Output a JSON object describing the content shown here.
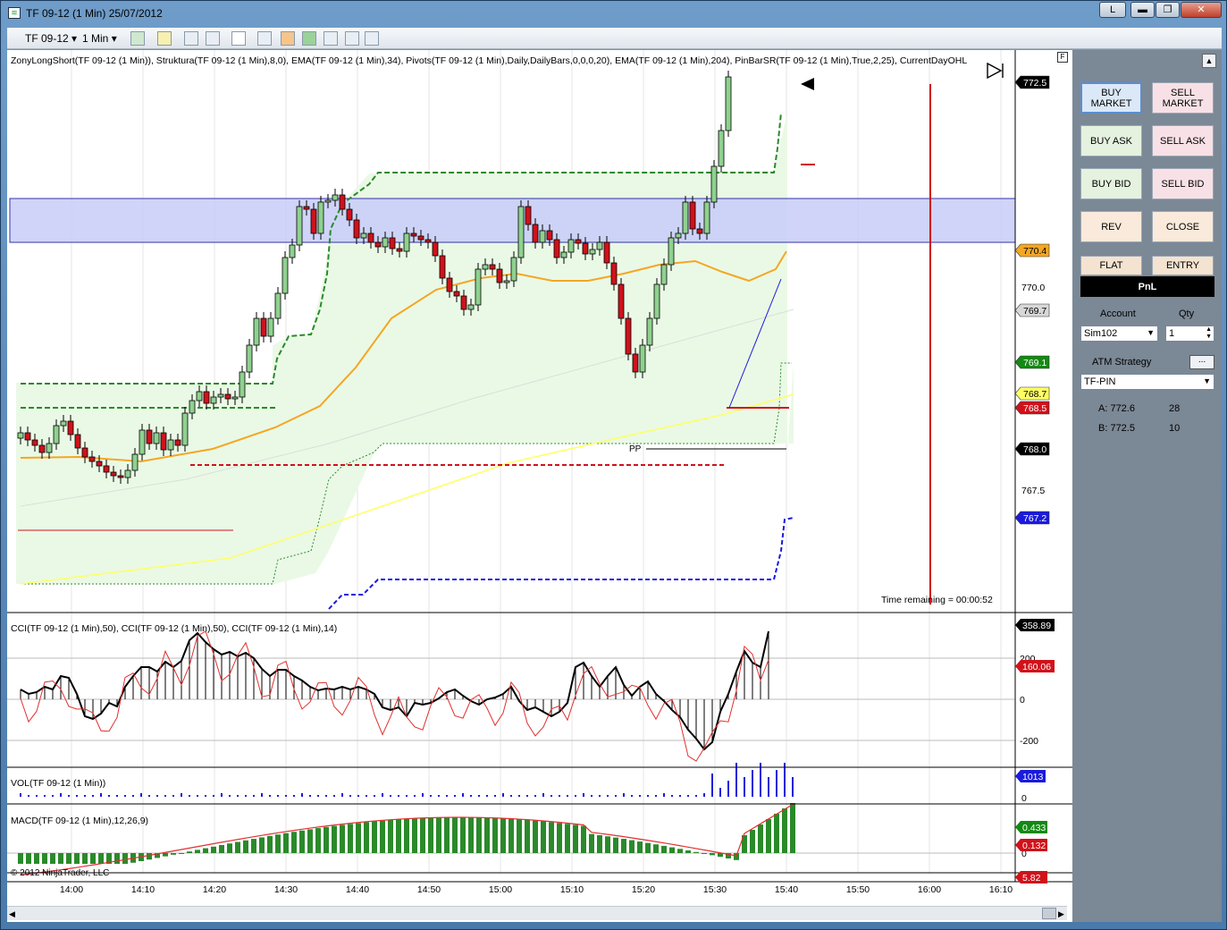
{
  "window": {
    "title": "TF 09-12 (1 Min)  25/07/2012",
    "buttons": {
      "l": "L",
      "minimize": "▬",
      "maximize": "❐",
      "close": "✕"
    }
  },
  "toolbar": {
    "instrument": "TF 09-12",
    "interval": "1 Min",
    "dropdown_glyph": "▾"
  },
  "price_panel": {
    "indicator_label": "ZonyLongShort(TF 09-12 (1 Min)), Struktura(TF 09-12 (1 Min),8,0), EMA(TF 09-12 (1 Min),34), Pivots(TF 09-12 (1 Min),Daily,DailyBars,0,0,0,20), EMA(TF 09-12 (1 Min),204), PinBarSR(TF 09-12 (1 Min),True,2,25), CurrentDayOHL",
    "pivot_label": "PP",
    "time_remaining": "Time remaining = 00:00:52",
    "axis_ticks": [
      "770.0",
      "767.5"
    ],
    "price_markers": [
      {
        "value": "772.5",
        "bg": "#000000",
        "fg": "#ffffff"
      },
      {
        "value": "770.4",
        "bg": "#f5a623",
        "fg": "#000000"
      },
      {
        "value": "769.7",
        "bg": "#d8d8d8",
        "fg": "#000000"
      },
      {
        "value": "769.1",
        "bg": "#138a13",
        "fg": "#ffffff"
      },
      {
        "value": "768.7",
        "bg": "#ffff66",
        "fg": "#000000"
      },
      {
        "value": "768.5",
        "bg": "#d0121b",
        "fg": "#ffffff"
      },
      {
        "value": "768.0",
        "bg": "#000000",
        "fg": "#ffffff"
      },
      {
        "value": "767.2",
        "bg": "#1a1adc",
        "fg": "#ffffff"
      }
    ]
  },
  "cci_panel": {
    "label": "CCI(TF 09-12 (1 Min),50), CCI(TF 09-12 (1 Min),50), CCI(TF 09-12 (1 Min),14)",
    "axis_ticks": [
      "200",
      "0",
      "-200"
    ],
    "markers": [
      {
        "value": "358.89",
        "bg": "#000000",
        "fg": "#ffffff"
      },
      {
        "value": "160.06",
        "bg": "#d0121b",
        "fg": "#ffffff"
      }
    ]
  },
  "vol_panel": {
    "label": "VOL(TF 09-12 (1 Min))",
    "axis_ticks": [
      "0"
    ],
    "markers": [
      {
        "value": "1013",
        "bg": "#1a1adc",
        "fg": "#ffffff"
      }
    ]
  },
  "macd_panel": {
    "label": "MACD(TF 09-12 (1 Min),12,26,9)",
    "axis_ticks": [
      "0"
    ],
    "markers": [
      {
        "value": "0.433",
        "bg": "#138a13",
        "fg": "#ffffff"
      },
      {
        "value": "0.132",
        "bg": "#d0121b",
        "fg": "#ffffff"
      },
      {
        "value": "5.82",
        "bg": "#d0121b",
        "fg": "#ffffff"
      }
    ]
  },
  "copyright": "© 2012 NinjaTrader, LLC",
  "time_axis": [
    "14:00",
    "14:10",
    "14:20",
    "14:30",
    "14:40",
    "14:50",
    "15:00",
    "15:10",
    "15:20",
    "15:30",
    "15:40",
    "15:50",
    "16:00",
    "16:10"
  ],
  "side_panel": {
    "buy_market": "BUY MARKET",
    "sell_market": "SELL MARKET",
    "buy_ask": "BUY ASK",
    "sell_ask": "SELL ASK",
    "buy_bid": "BUY BID",
    "sell_bid": "SELL BID",
    "rev": "REV",
    "close": "CLOSE",
    "flat": "FLAT",
    "entry": "ENTRY",
    "pnl": "PnL",
    "account_label": "Account",
    "qty_label": "Qty",
    "account_value": "Sim102",
    "qty_value": "1",
    "atm_label": "ATM Strategy",
    "atm_button": "...",
    "atm_value": "TF-PIN",
    "ask_label": "A: 772.6",
    "ask_size": "28",
    "bid_label": "B: 772.5",
    "bid_size": "10"
  },
  "colors": {
    "bull": "#8fd18f",
    "bear": "#d0121b",
    "ema34": "#f5a623",
    "ema204": "#ffff66",
    "zone": "#c8ccf8",
    "struktura": "#2a8a2a",
    "pivot_blue": "#1a1adc"
  }
}
